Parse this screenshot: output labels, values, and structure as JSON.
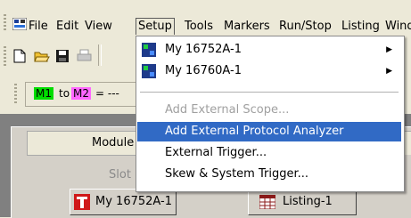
{
  "menubar": {
    "items": [
      {
        "label": "File",
        "underline": "F"
      },
      {
        "label": "Edit",
        "underline": "E"
      },
      {
        "label": "View",
        "underline": "V"
      },
      {
        "label": "Setup",
        "underline": "S"
      },
      {
        "label": "Tools",
        "underline": "T"
      },
      {
        "label": "Markers",
        "underline": "M"
      },
      {
        "label": "Run/Stop",
        "underline": "R"
      },
      {
        "label": "Listing",
        "underline": "L"
      },
      {
        "label": "Wind",
        "underline": "W"
      }
    ]
  },
  "marker_bar": {
    "m1": "M1",
    "to": "to",
    "m2": "M2",
    "eq": "= ---"
  },
  "module_panel": {
    "header": "Module",
    "slot_label": "Slot",
    "card1": "My 16752A-1",
    "card2": "Listing-1"
  },
  "setup_menu": {
    "items": [
      {
        "label": "My 16752A-1",
        "submenu": true
      },
      {
        "label": "My 16760A-1",
        "submenu": true
      },
      {
        "label": "Add External Scope...",
        "disabled": true
      },
      {
        "label": "Add External Protocol Analyzer",
        "highlighted": true
      },
      {
        "label": "External Trigger..."
      },
      {
        "label": "Skew & System Trigger..."
      }
    ]
  },
  "colors": {
    "highlight": "#316ac5",
    "m1": "#00dd00",
    "m2": "#ff66ff",
    "chrome": "#ece9d8"
  }
}
